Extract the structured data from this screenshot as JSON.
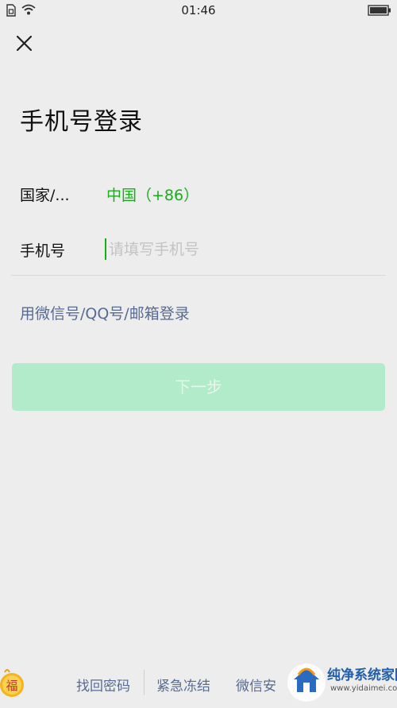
{
  "status_bar": {
    "time": "01:46",
    "icons": [
      "sim-card-icon",
      "wifi-icon",
      "battery-icon"
    ],
    "text_color": "#222222"
  },
  "nav": {
    "close_icon": "close-icon"
  },
  "page": {
    "title": "手机号登录"
  },
  "form": {
    "country_label": "国家/...",
    "country_value": "中国（+86）",
    "phone_label": "手机号",
    "phone_value": "",
    "phone_placeholder": "请填写手机号",
    "alt_login_label": "用微信号/QQ号/邮箱登录",
    "next_label": "下一步"
  },
  "footer": {
    "links": [
      "找回密码",
      "紧急冻结",
      "微信安全中心"
    ],
    "links_visible_text": [
      "找回密码",
      "紧急冻结",
      "微信安"
    ],
    "badge_text": "福",
    "watermark_text": "纯净系统家园",
    "watermark_url": "www.yidaimei.com"
  },
  "colors": {
    "background": "#ededed",
    "accent_green": "#1aad19",
    "link_blue": "#576b95",
    "button_disabled_bg": "#b2ebc9",
    "button_disabled_text": "#e5f8ec",
    "placeholder": "#c3c3c3",
    "divider": "#d9d9d9"
  }
}
